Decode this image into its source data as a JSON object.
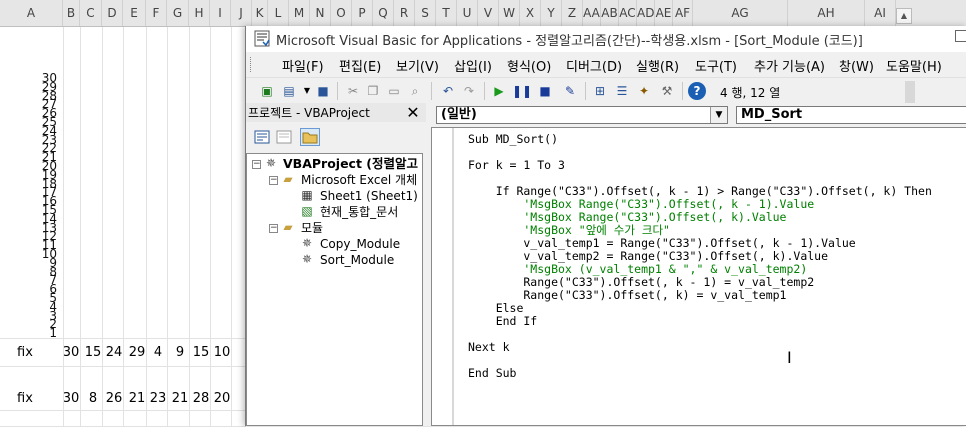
{
  "excel": {
    "column_headers": [
      "A",
      "B",
      "C",
      "D",
      "E",
      "F",
      "G",
      "H",
      "I",
      "J",
      "K",
      "L",
      "M",
      "N",
      "O",
      "P",
      "Q",
      "R",
      "S",
      "T",
      "U",
      "V",
      "W",
      "X",
      "Y",
      "Z",
      "AA",
      "AB",
      "AC",
      "AD",
      "AE",
      "AF",
      "AG",
      "AH",
      "AI"
    ],
    "axis_labels": [
      "30",
      "29",
      "28",
      "27",
      "26",
      "25",
      "24",
      "23",
      "22",
      "21",
      "20",
      "19",
      "18",
      "17",
      "16",
      "15",
      "14",
      "13",
      "12",
      "11",
      "10",
      "9",
      "8",
      "7",
      "6",
      "5",
      "4",
      "3",
      "2",
      "1"
    ],
    "row1": {
      "label": "fix",
      "values": [
        "30",
        "15",
        "24",
        "29",
        "4",
        "9",
        "15",
        "10"
      ]
    },
    "row2": {
      "label": "fix",
      "values": [
        "30",
        "8",
        "26",
        "21",
        "23",
        "21",
        "28",
        "20"
      ]
    }
  },
  "vbe": {
    "title": "Microsoft Visual Basic for Applications - 정렬알고리즘(간단)--학생용.xlsm - [Sort_Module (코드)]",
    "menus": [
      "파일(F)",
      "편집(E)",
      "보기(V)",
      "삽입(I)",
      "형식(O)",
      "디버그(D)",
      "실행(R)",
      "도구(T)",
      "추가 기능(A)",
      "창(W)",
      "도움말(H)"
    ],
    "toolbar": {
      "cursor_position": "4 행, 12 열"
    },
    "project_explorer": {
      "title": "프로젝트 - VBAProject",
      "close_glyph": "✕",
      "tree": {
        "root": "VBAProject (정렬알고",
        "excel_objects_folder": "Microsoft Excel 개체",
        "sheet1": "Sheet1 (Sheet1)",
        "workbook": "현재_통합_문서",
        "modules_folder": "모듈",
        "module1": "Copy_Module",
        "module2": "Sort_Module"
      }
    },
    "code": {
      "object_combo": "(일반)",
      "proc_combo": "MD_Sort",
      "lines": [
        {
          "text": "Sub MD_Sort()",
          "kind": "code"
        },
        {
          "text": "",
          "kind": "code"
        },
        {
          "text": "For k = 1 To 3",
          "kind": "code"
        },
        {
          "text": "",
          "kind": "code"
        },
        {
          "text": "    If Range(\"C33\").Offset(, k - 1) > Range(\"C33\").Offset(, k) Then",
          "kind": "code"
        },
        {
          "text": "        'MsgBox Range(\"C33\").Offset(, k - 1).Value",
          "kind": "comment"
        },
        {
          "text": "        'MsgBox Range(\"C33\").Offset(, k).Value",
          "kind": "comment"
        },
        {
          "text": "        'MsgBox \"앞에 수가 크다\"",
          "kind": "comment"
        },
        {
          "text": "        v_val_temp1 = Range(\"C33\").Offset(, k - 1).Value",
          "kind": "code"
        },
        {
          "text": "        v_val_temp2 = Range(\"C33\").Offset(, k).Value",
          "kind": "code"
        },
        {
          "text": "        'MsgBox (v_val_temp1 & \",\" & v_val_temp2)",
          "kind": "comment"
        },
        {
          "text": "        Range(\"C33\").Offset(, k - 1) = v_val_temp2",
          "kind": "code"
        },
        {
          "text": "        Range(\"C33\").Offset(, k) = v_val_temp1",
          "kind": "code"
        },
        {
          "text": "    Else",
          "kind": "code"
        },
        {
          "text": "    End If",
          "kind": "code"
        },
        {
          "text": "",
          "kind": "code"
        },
        {
          "text": "Next k",
          "kind": "code"
        },
        {
          "text": "",
          "kind": "code"
        },
        {
          "text": "End Sub",
          "kind": "code"
        }
      ]
    }
  }
}
